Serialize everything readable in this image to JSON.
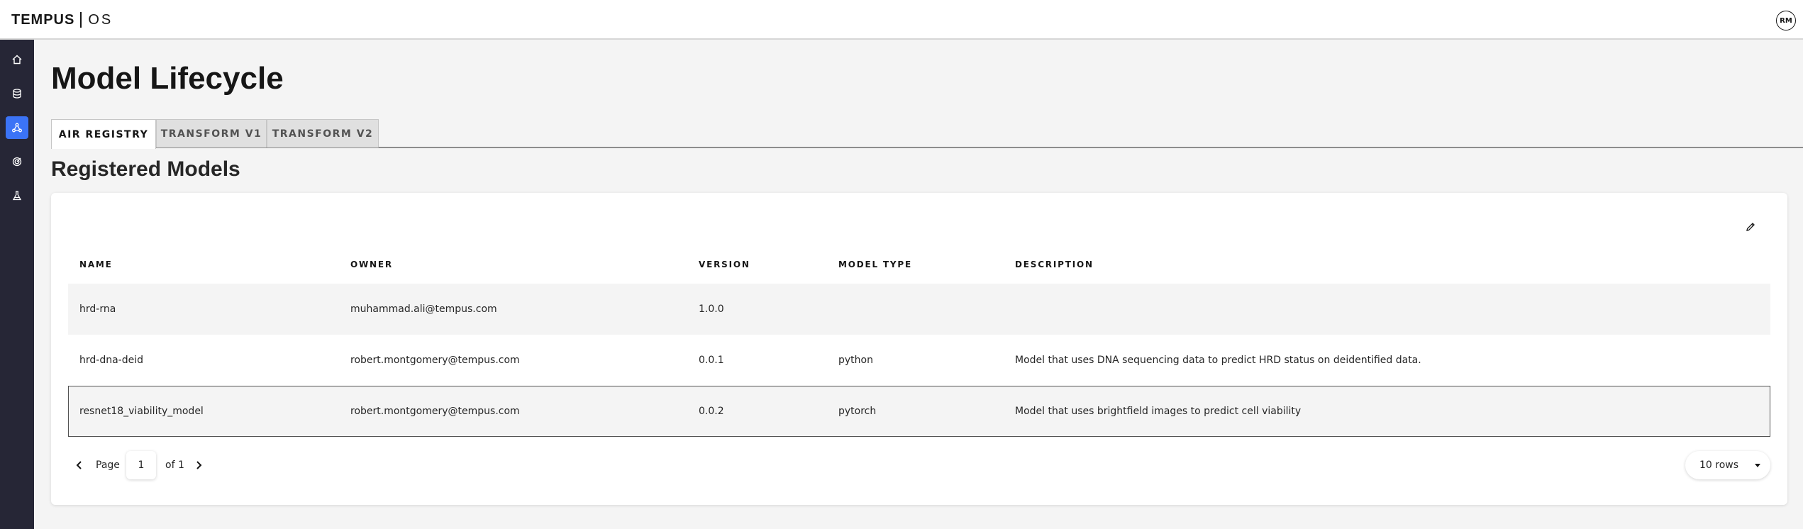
{
  "header": {
    "brand": "TEMPUS",
    "product": "OS",
    "avatar_initials": "RM"
  },
  "sidebar": {
    "items": [
      {
        "name": "home-icon",
        "active": false
      },
      {
        "name": "database-icon",
        "active": false
      },
      {
        "name": "model-network-icon",
        "active": true
      },
      {
        "name": "radar-icon",
        "active": false
      },
      {
        "name": "flask-icon",
        "active": false
      }
    ]
  },
  "page": {
    "title": "Model Lifecycle",
    "tabs": [
      {
        "label": "AIR REGISTRY",
        "active": true
      },
      {
        "label": "TRANSFORM V1",
        "active": false
      },
      {
        "label": "TRANSFORM V2",
        "active": false
      }
    ],
    "section_title": "Registered Models"
  },
  "table": {
    "columns": [
      "NAME",
      "OWNER",
      "VERSION",
      "MODEL TYPE",
      "DESCRIPTION"
    ],
    "rows": [
      {
        "name": "hrd-rna",
        "owner": "muhammad.ali@tempus.com",
        "version": "1.0.0",
        "model_type": "",
        "description": ""
      },
      {
        "name": "hrd-dna-deid",
        "owner": "robert.montgomery@tempus.com",
        "version": "0.0.1",
        "model_type": "python",
        "description": "Model that uses DNA sequencing data to predict HRD status on deidentified data."
      },
      {
        "name": "resnet18_viability_model",
        "owner": "robert.montgomery@tempus.com",
        "version": "0.0.2",
        "model_type": "pytorch",
        "description": "Model that uses brightfield images to predict cell viability"
      }
    ]
  },
  "pagination": {
    "page_label": "Page",
    "current_page": "1",
    "of_label": "of 1",
    "rows_per_page": "10 rows"
  },
  "colors": {
    "accent": "#3b73f6",
    "sidebar_bg": "#262636"
  }
}
